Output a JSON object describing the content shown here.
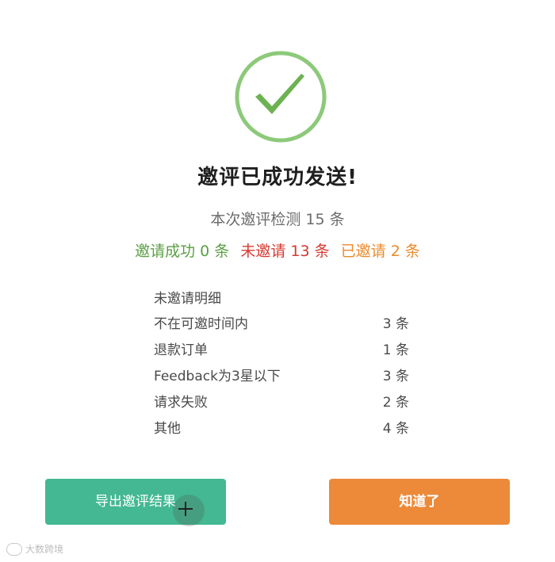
{
  "dialog": {
    "title": "邀评已成功发送!",
    "summary": "本次邀评检测 15 条",
    "stats": {
      "success": "邀请成功 0 条",
      "not_invited": "未邀请 13 条",
      "already_invited": "已邀请 2 条"
    },
    "detail": {
      "title": "未邀请明细",
      "rows": [
        {
          "label": "不在可邀时间内",
          "count": "3 条"
        },
        {
          "label": "退款订单",
          "count": "1 条"
        },
        {
          "label": "Feedback为3星以下",
          "count": "3 条"
        },
        {
          "label": "请求失败",
          "count": "2 条"
        },
        {
          "label": "其他",
          "count": "4 条"
        }
      ]
    },
    "buttons": {
      "export": "导出邀评结果",
      "ok": "知道了"
    }
  },
  "watermark": "大数跨境",
  "colors": {
    "success_green": "#5aa043",
    "error_red": "#d63a2f",
    "warning_orange": "#ea8a2c",
    "export_button": "#43b892",
    "ok_button": "#ec8a3a"
  },
  "icons": {
    "status": "check-circle-icon"
  }
}
